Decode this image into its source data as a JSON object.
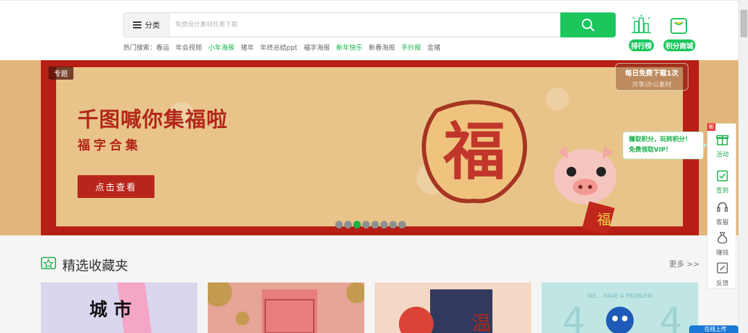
{
  "header": {
    "category_label": "分类",
    "search_placeholder": "免费设计素材任意下载",
    "hot_label": "热门搜索：",
    "hot_terms": [
      "春运",
      "年会视频",
      "小年海报",
      "猪年",
      "年终总结ppt",
      "福字海报",
      "新年快乐",
      "新春海报",
      "手抄报",
      "金猪"
    ],
    "ranking_label": "排行榜",
    "points_mall_label": "积分商城",
    "accent_color": "#1bc65d"
  },
  "banner": {
    "topic_tag": "专题",
    "free_line1": "每日免费下载1次",
    "free_line2": "共享/办公素材",
    "title": "千图喊你集福啦",
    "subtitle": "福字合集",
    "cta": "点击查看",
    "slides": 8,
    "active_slide": 3
  },
  "section": {
    "title": "精选收藏夹",
    "more": "更多 >>",
    "cards": [
      {
        "text": "城 市"
      },
      {
        "text": ""
      },
      {
        "text": "温"
      },
      {
        "text": "WE... HAVE A PROBLEM"
      }
    ]
  },
  "sidebar": {
    "new_badge": "新",
    "tooltip_line1": "赚取积分，玩转积分！",
    "tooltip_line2": "免费领取VIP！",
    "items": [
      {
        "label": "活动",
        "icon": "gift-icon"
      },
      {
        "label": "签到",
        "icon": "checkin-icon"
      },
      {
        "label": "客服",
        "icon": "headset-icon"
      },
      {
        "label": "赚钱",
        "icon": "moneybag-icon"
      },
      {
        "label": "反馈",
        "icon": "feedback-icon"
      }
    ]
  },
  "login_chip": "在线上传"
}
